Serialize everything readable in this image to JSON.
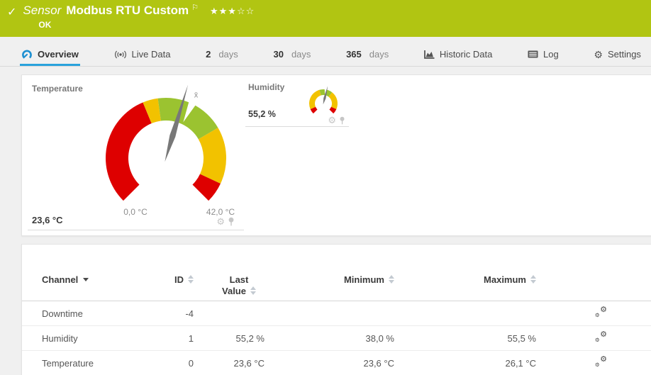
{
  "header": {
    "color": "#b1c512",
    "status_glyph": "✓",
    "kind": "Sensor",
    "title": "Modbus RTU Custom",
    "flag_glyph": "⚐",
    "stars_filled": "★★★",
    "stars_empty": "☆☆",
    "status": "OK"
  },
  "icons": {
    "gear_glyph": "⚙"
  },
  "accent": {
    "active_tab_underline": "#2aa2dc",
    "overview_icon_blue": "#1d8fd1"
  },
  "tabs": [
    {
      "label": "Overview",
      "icon": "gauge-icon",
      "active": true
    },
    {
      "label": "Live Data",
      "icon": "broadcast-icon",
      "active": false
    },
    {
      "value": "2",
      "unit": "days",
      "active": false
    },
    {
      "value": "30",
      "unit": "days",
      "active": false
    },
    {
      "value": "365",
      "unit": "days",
      "active": false
    },
    {
      "label": "Historic Data",
      "icon": "area-chart-icon",
      "active": false
    },
    {
      "label": "Log",
      "icon": "log-icon",
      "active": false
    },
    {
      "label": "Settings",
      "icon": "gear-icon",
      "active": false
    }
  ],
  "chart_data": [
    {
      "type": "gauge",
      "title": "Temperature",
      "value": 23.6,
      "value_label": "23,6 °C",
      "min": 0,
      "max": 42,
      "min_label": "0,0 °C",
      "max_label": "42,0 °C",
      "average": 25,
      "average_marker": "x̄",
      "sweep_degrees": 270,
      "segments": [
        {
          "from": 0,
          "to": 17.5,
          "color": "#de0000"
        },
        {
          "from": 17.5,
          "to": 19.8,
          "color": "#f2c200"
        },
        {
          "from": 19.8,
          "to": 30.3,
          "color": "#9bc330"
        },
        {
          "from": 30.3,
          "to": 38.9,
          "color": "#f2c200"
        },
        {
          "from": 38.9,
          "to": 42,
          "color": "#de0000"
        }
      ]
    },
    {
      "type": "gauge",
      "title": "Humidity",
      "value": 55.2,
      "value_label": "55,2 %",
      "min": 0,
      "max": 100,
      "average": 53.5,
      "sweep_degrees": 270,
      "segments": [
        {
          "from": 0,
          "to": 8,
          "color": "#de0000"
        },
        {
          "from": 8,
          "to": 44,
          "color": "#f2c200"
        },
        {
          "from": 44,
          "to": 64,
          "color": "#9bc330"
        },
        {
          "from": 64,
          "to": 92,
          "color": "#f2c200"
        },
        {
          "from": 92,
          "to": 100,
          "color": "#de0000"
        }
      ]
    }
  ],
  "table": {
    "columns": [
      {
        "label": "Channel",
        "sort": "active-desc"
      },
      {
        "label": "ID",
        "sort": "none"
      },
      {
        "label": "Last Value",
        "line1": "Last",
        "line2": "Value",
        "sort": "none"
      },
      {
        "label": "Minimum",
        "sort": "none"
      },
      {
        "label": "Maximum",
        "sort": "none"
      }
    ],
    "rows": [
      {
        "channel": "Downtime",
        "id": "-4",
        "last_value": "",
        "minimum": "",
        "maximum": ""
      },
      {
        "channel": "Humidity",
        "id": "1",
        "last_value": "55,2 %",
        "minimum": "38,0 %",
        "maximum": "55,5 %"
      },
      {
        "channel": "Temperature",
        "id": "0",
        "last_value": "23,6 °C",
        "minimum": "23,6 °C",
        "maximum": "26,1 °C"
      }
    ]
  }
}
